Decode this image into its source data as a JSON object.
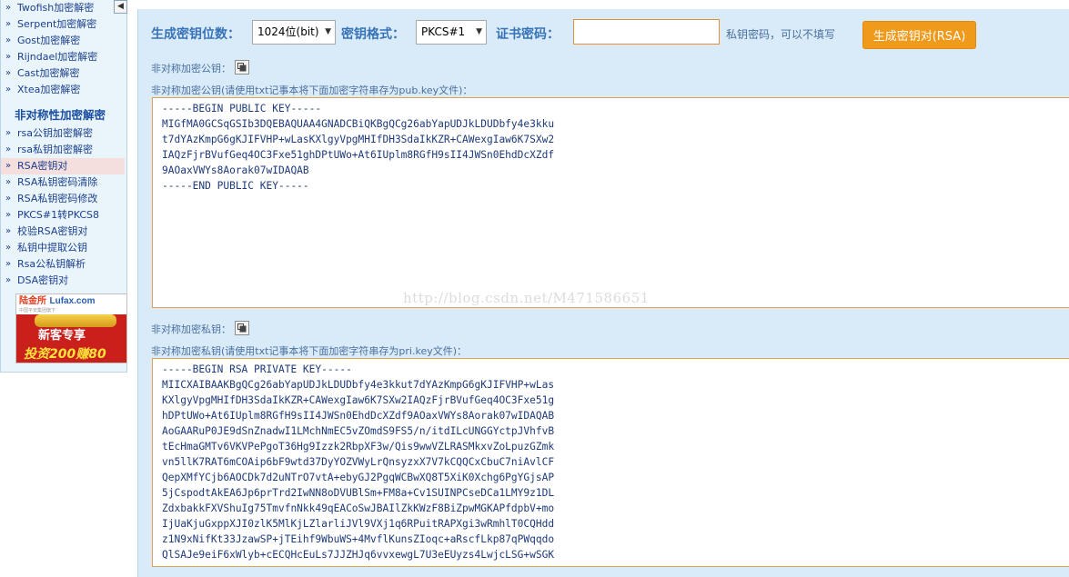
{
  "sidebar": {
    "collapse_arrow": "◀",
    "top_items": [
      "Twofish加密解密",
      "Serpent加密解密",
      "Gost加密解密",
      "Rijndael加密解密",
      "Cast加密解密",
      "Xtea加密解密"
    ],
    "section_title": "非对称性加密解密",
    "items": [
      "rsa公钥加密解密",
      "rsa私钥加密解密",
      "RSA密钥对",
      "RSA私钥密码清除",
      "RSA私钥密码修改",
      "PKCS#1转PKCS8",
      "校验RSA密钥对",
      "私钥中提取公钥",
      "Rsa公私钥解析",
      "DSA密钥对"
    ],
    "active_index": 2,
    "ad": {
      "brand_cn": "陆金所",
      "brand_en": "Lufax.com",
      "sub": "中国平安集团旗下",
      "line1": "新客专享",
      "line2": "投资200赚80"
    }
  },
  "form": {
    "bits_label": "生成密钥位数：",
    "bits_value": "1024位(bit)",
    "format_label": "密钥格式：",
    "format_value": "PKCS#1",
    "password_label": "证书密码：",
    "password_value": "",
    "password_hint": "私钥密码，可以不填写",
    "generate_button": "生成密钥对(RSA)"
  },
  "public_key": {
    "title": "非对称加密公钥：",
    "instruction": "非对称加密公钥(请使用txt记事本将下面加密字符串存为pub.key文件)：",
    "text": "-----BEGIN PUBLIC KEY-----\nMIGfMA0GCSqGSIb3DQEBAQUAA4GNADCBiQKBgQCg26abYapUDJkLDUDbfy4e3kku\nt7dYAzKmpG6gKJIFVHP+wLasKXlgyVpgMHIfDH3SdaIkKZR+CAWexgIaw6K7SXw2\nIAQzFjrBVufGeq4OC3Fxe51ghDPtUWo+At6IUplm8RGfH9sII4JWSn0EhdDcXZdf\n9AOaxVWYs8Aorak07wIDAQAB\n-----END PUBLIC KEY-----"
  },
  "private_key": {
    "title": "非对称加密私钥：",
    "instruction": "非对称加密私钥(请使用txt记事本将下面加密字符串存为pri.key文件)：",
    "text": "-----BEGIN RSA PRIVATE KEY-----\nMIICXAIBAAKBgQCg26abYapUDJkLDUDbfy4e3kkut7dYAzKmpG6gKJIFVHP+wLas\nKXlgyVpgMHIfDH3SdaIkKZR+CAWexgIaw6K7SXw2IAQzFjrBVufGeq4OC3Fxe51g\nhDPtUWo+At6IUplm8RGfH9sII4JWSn0EhdDcXZdf9AOaxVWYs8Aorak07wIDAQAB\nAoGAARuP0JE9dSnZnadwI1LMchNmEC5vZOmdS9FS5/n/itdILcUNGGYctpJVhfvB\ntEcHmaGMTv6VKVPePgoT36Hg9Izzk2RbpXF3w/Qis9wwVZLRASMkxvZoLpuzGZmk\nvn5llK7RAT6mCOAip6bF9wtd37DyYOZVWyLrQnsyzxX7V7kCQQCxCbuC7niAvlCF\nQepXMfYCjb6AOCDk7d2uNTrO7vtA+ebyGJ2PgqWCBwXQ8T5XiK0Xchg6PgYGjsAP\n5jCspodtAkEA6Jp6prTrd2IwNN8oDVUBlSm+FM8a+Cv1SUINPCseDCa1LMY9z1DL\nZdxbakkFXVShuIg75TmvfnNkk49qEACoSwJBAIlZkKWzF8BiZpwMGKAPfdpbV+mo\nIjUaKjuGxppXJI0zlK5MlKjLZlarliJVl9VXj1q6RPuitRAPXgi3wRmhlT0CQHdd\nz1N9xNifKt33JzawSP+jTEihf9WbuWS+4MvflKunsZIoqc+aRscfLkp87qPWqqdo\nQlSAJe9eiF6xWlyb+cECQHcEuLs7JJZHJq6vvxewgL7U3eEUyzs4LwjcLSG+wSGK"
  },
  "watermark": "http://blog.csdn.net/M471586651"
}
